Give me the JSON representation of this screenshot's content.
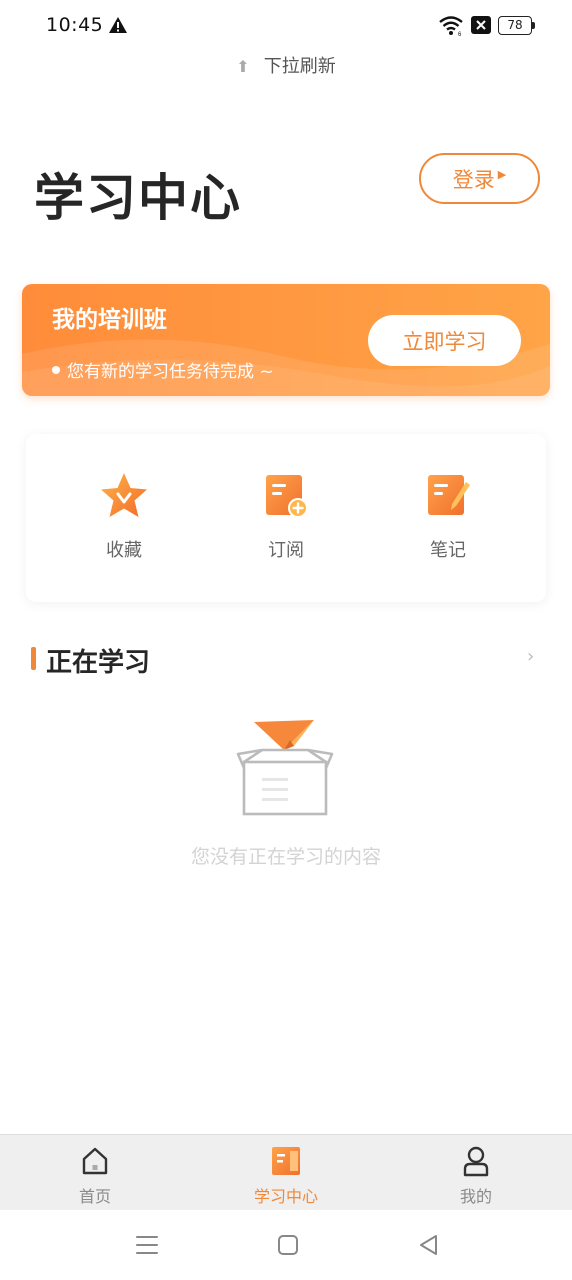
{
  "status_bar": {
    "time": "10:45",
    "battery": "78"
  },
  "refresh_hint": "下拉刷新",
  "header": {
    "title": "学习中心",
    "login_label": "登录"
  },
  "banner": {
    "title": "我的培训班",
    "subtitle": "您有新的学习任务待完成 ~",
    "button_label": "立即学习"
  },
  "quick_actions": [
    {
      "label": "收藏",
      "icon": "star-icon"
    },
    {
      "label": "订阅",
      "icon": "subscribe-icon"
    },
    {
      "label": "笔记",
      "icon": "note-icon"
    }
  ],
  "section": {
    "title": "正在学习"
  },
  "empty_state": {
    "text": "您没有正在学习的内容"
  },
  "tabbar": {
    "items": [
      {
        "label": "首页",
        "icon": "home-icon",
        "active": false
      },
      {
        "label": "学习中心",
        "icon": "study-center-icon",
        "active": true
      },
      {
        "label": "我的",
        "icon": "profile-icon",
        "active": false
      }
    ]
  },
  "colors": {
    "accent": "#f0883a",
    "banner_start": "#ff8c3a",
    "banner_end": "#ffa447"
  }
}
